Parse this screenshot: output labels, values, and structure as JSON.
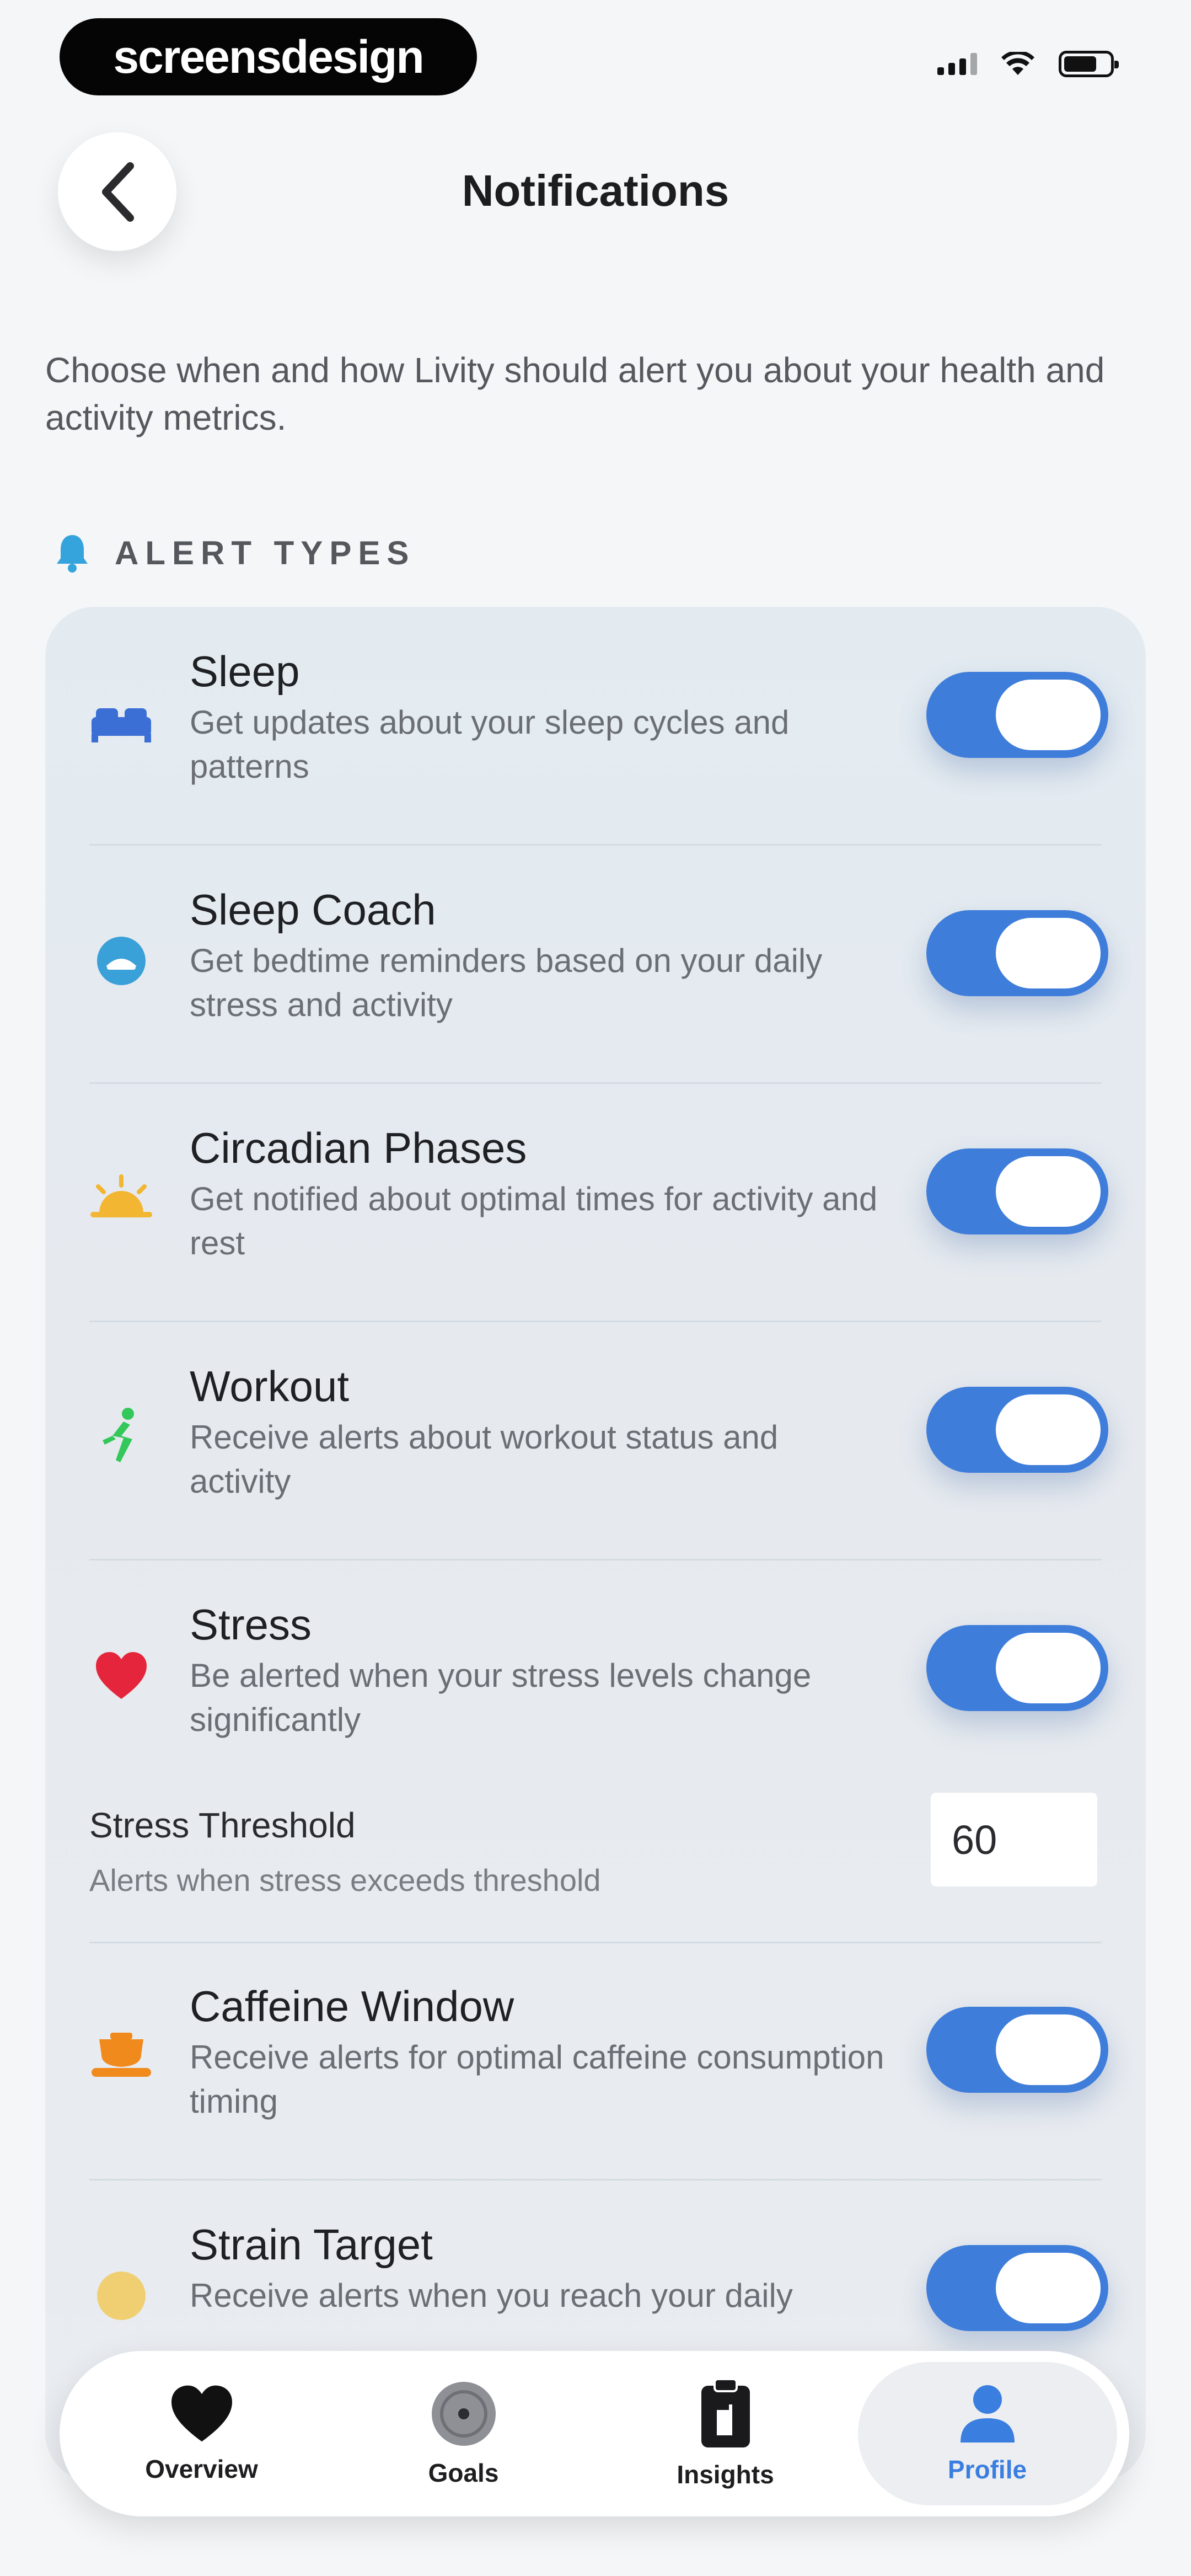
{
  "status_bar": {
    "watermark": "screensdesign"
  },
  "header": {
    "title": "Notifications"
  },
  "intro": "Choose when and how Livity should alert you about your health and activity metrics.",
  "section": {
    "label": "ALERT TYPES"
  },
  "alerts": [
    {
      "title": "Sleep",
      "desc": "Get updates about your sleep cycles and patterns",
      "icon": "bed-icon",
      "enabled": true
    },
    {
      "title": "Sleep Coach",
      "desc": "Get bedtime reminders based on your daily stress and activity",
      "icon": "sleep-coach-icon",
      "enabled": true
    },
    {
      "title": "Circadian Phases",
      "desc": "Get notified about optimal times for activity and rest",
      "icon": "sunrise-icon",
      "enabled": true
    },
    {
      "title": "Workout",
      "desc": "Receive alerts about workout status and activity",
      "icon": "running-icon",
      "enabled": true
    },
    {
      "title": "Stress",
      "desc": "Be alerted when your stress levels change significantly",
      "icon": "heart-icon",
      "enabled": true
    }
  ],
  "threshold": {
    "title": "Stress Threshold",
    "desc": "Alerts when stress exceeds threshold",
    "value": "60"
  },
  "alerts_more": [
    {
      "title": "Caffeine Window",
      "desc": "Receive alerts for optimal caffeine consumption timing",
      "icon": "coffee-icon",
      "enabled": true
    },
    {
      "title": "Strain Target",
      "desc": "Receive alerts when you reach your daily",
      "icon": "strain-icon",
      "enabled": true
    }
  ],
  "tabs": [
    {
      "label": "Overview",
      "icon": "heart-icon",
      "active": false
    },
    {
      "label": "Goals",
      "icon": "target-icon",
      "active": false
    },
    {
      "label": "Insights",
      "icon": "clipboard-icon",
      "active": false
    },
    {
      "label": "Profile",
      "icon": "person-icon",
      "active": true
    }
  ],
  "colors": {
    "accent": "#3f7ddb",
    "card": "#e4ebf1",
    "background": "#f5f6f8"
  }
}
